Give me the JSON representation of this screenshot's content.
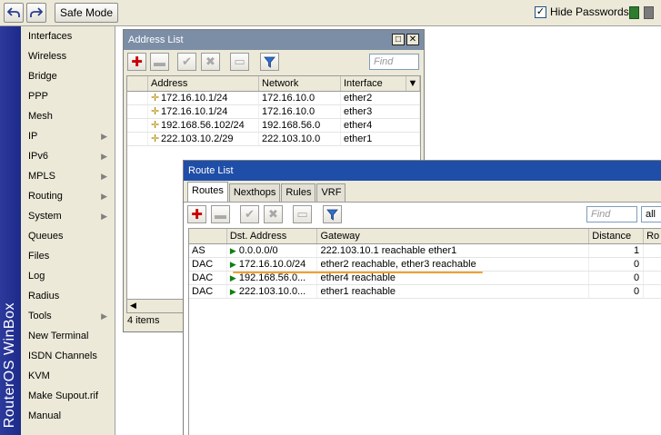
{
  "toolbar": {
    "undo_icon": "undo-icon",
    "redo_icon": "redo-icon",
    "safe_mode_label": "Safe Mode",
    "hide_passwords_label": "Hide Passwords",
    "hide_passwords_checked": "✓",
    "status_colors": [
      "#2e7d2e",
      "#7a7a7a"
    ]
  },
  "sidebar": {
    "brand": "RouterOS WinBox",
    "items": [
      {
        "label": "Interfaces",
        "arrow": ""
      },
      {
        "label": "Wireless",
        "arrow": ""
      },
      {
        "label": "Bridge",
        "arrow": ""
      },
      {
        "label": "PPP",
        "arrow": ""
      },
      {
        "label": "Mesh",
        "arrow": ""
      },
      {
        "label": "IP",
        "arrow": "▶"
      },
      {
        "label": "IPv6",
        "arrow": "▶"
      },
      {
        "label": "MPLS",
        "arrow": "▶"
      },
      {
        "label": "Routing",
        "arrow": "▶"
      },
      {
        "label": "System",
        "arrow": "▶"
      },
      {
        "label": "Queues",
        "arrow": ""
      },
      {
        "label": "Files",
        "arrow": ""
      },
      {
        "label": "Log",
        "arrow": ""
      },
      {
        "label": "Radius",
        "arrow": ""
      },
      {
        "label": "Tools",
        "arrow": "▶"
      },
      {
        "label": "New Terminal",
        "arrow": ""
      },
      {
        "label": "ISDN Channels",
        "arrow": ""
      },
      {
        "label": "KVM",
        "arrow": ""
      },
      {
        "label": "Make Supout.rif",
        "arrow": ""
      },
      {
        "label": "Manual",
        "arrow": ""
      }
    ]
  },
  "address_list": {
    "title": "Address List",
    "find_placeholder": "Find",
    "columns": [
      "Address",
      "Network",
      "Interface"
    ],
    "rows": [
      {
        "address": "172.16.10.1/24",
        "network": "172.16.10.0",
        "interface": "ether2"
      },
      {
        "address": "172.16.10.1/24",
        "network": "172.16.10.0",
        "interface": "ether3"
      },
      {
        "address": "192.168.56.102/24",
        "network": "192.168.56.0",
        "interface": "ether4"
      },
      {
        "address": "222.103.10.2/29",
        "network": "222.103.10.0",
        "interface": "ether1"
      }
    ],
    "status": "4 items"
  },
  "route_list": {
    "title": "Route List",
    "tabs": [
      "Routes",
      "Nexthops",
      "Rules",
      "VRF"
    ],
    "find_placeholder": "Find",
    "filter_value": "all",
    "columns": [
      "",
      "Dst. Address",
      "Gateway",
      "Distance",
      "Ro"
    ],
    "rows": [
      {
        "flags": "AS",
        "dst": "0.0.0.0/0",
        "gateway": "222.103.10.1 reachable ether1",
        "distance": "1"
      },
      {
        "flags": "DAC",
        "dst": "172.16.10.0/24",
        "gateway": "ether2 reachable, ether3 reachable",
        "distance": "0"
      },
      {
        "flags": "DAC",
        "dst": "192.168.56.0...",
        "gateway": "ether4 reachable",
        "distance": "0"
      },
      {
        "flags": "DAC",
        "dst": "222.103.10.0...",
        "gateway": "ether1 reachable",
        "distance": "0"
      }
    ],
    "highlight_color": "#f0a030"
  }
}
